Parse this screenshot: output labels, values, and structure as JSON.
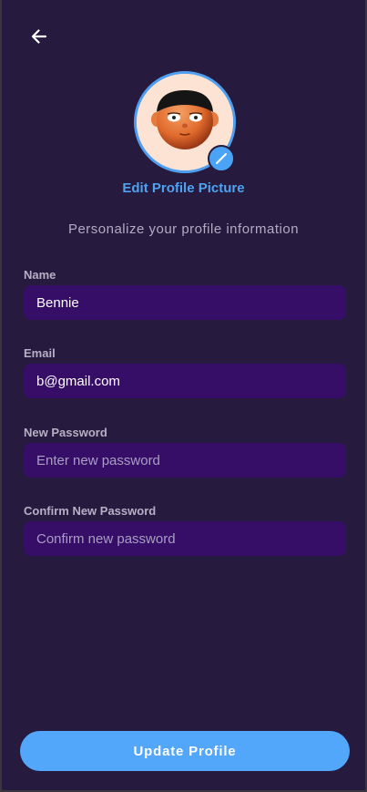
{
  "header": {
    "back_icon": "arrow-left-icon"
  },
  "profile": {
    "avatar_icon": "cartoon-avatar",
    "edit_badge_icon": "pencil-icon",
    "edit_picture_label": "Edit Profile Picture",
    "subtitle": "Personalize your profile information"
  },
  "form": {
    "name": {
      "label": "Name",
      "value": "Bennie",
      "placeholder": ""
    },
    "email": {
      "label": "Email",
      "value": "b@gmail.com",
      "placeholder": ""
    },
    "new_password": {
      "label": "New Password",
      "value": "",
      "placeholder": "Enter new password"
    },
    "confirm_password": {
      "label": "Confirm New Password",
      "value": "",
      "placeholder": "Confirm new password"
    }
  },
  "actions": {
    "update_label": "Update Profile"
  },
  "colors": {
    "background": "#261a3e",
    "input_background": "#360e68",
    "accent": "#52a7fb",
    "link": "#4ea2ef",
    "label": "#b6b0c4"
  }
}
